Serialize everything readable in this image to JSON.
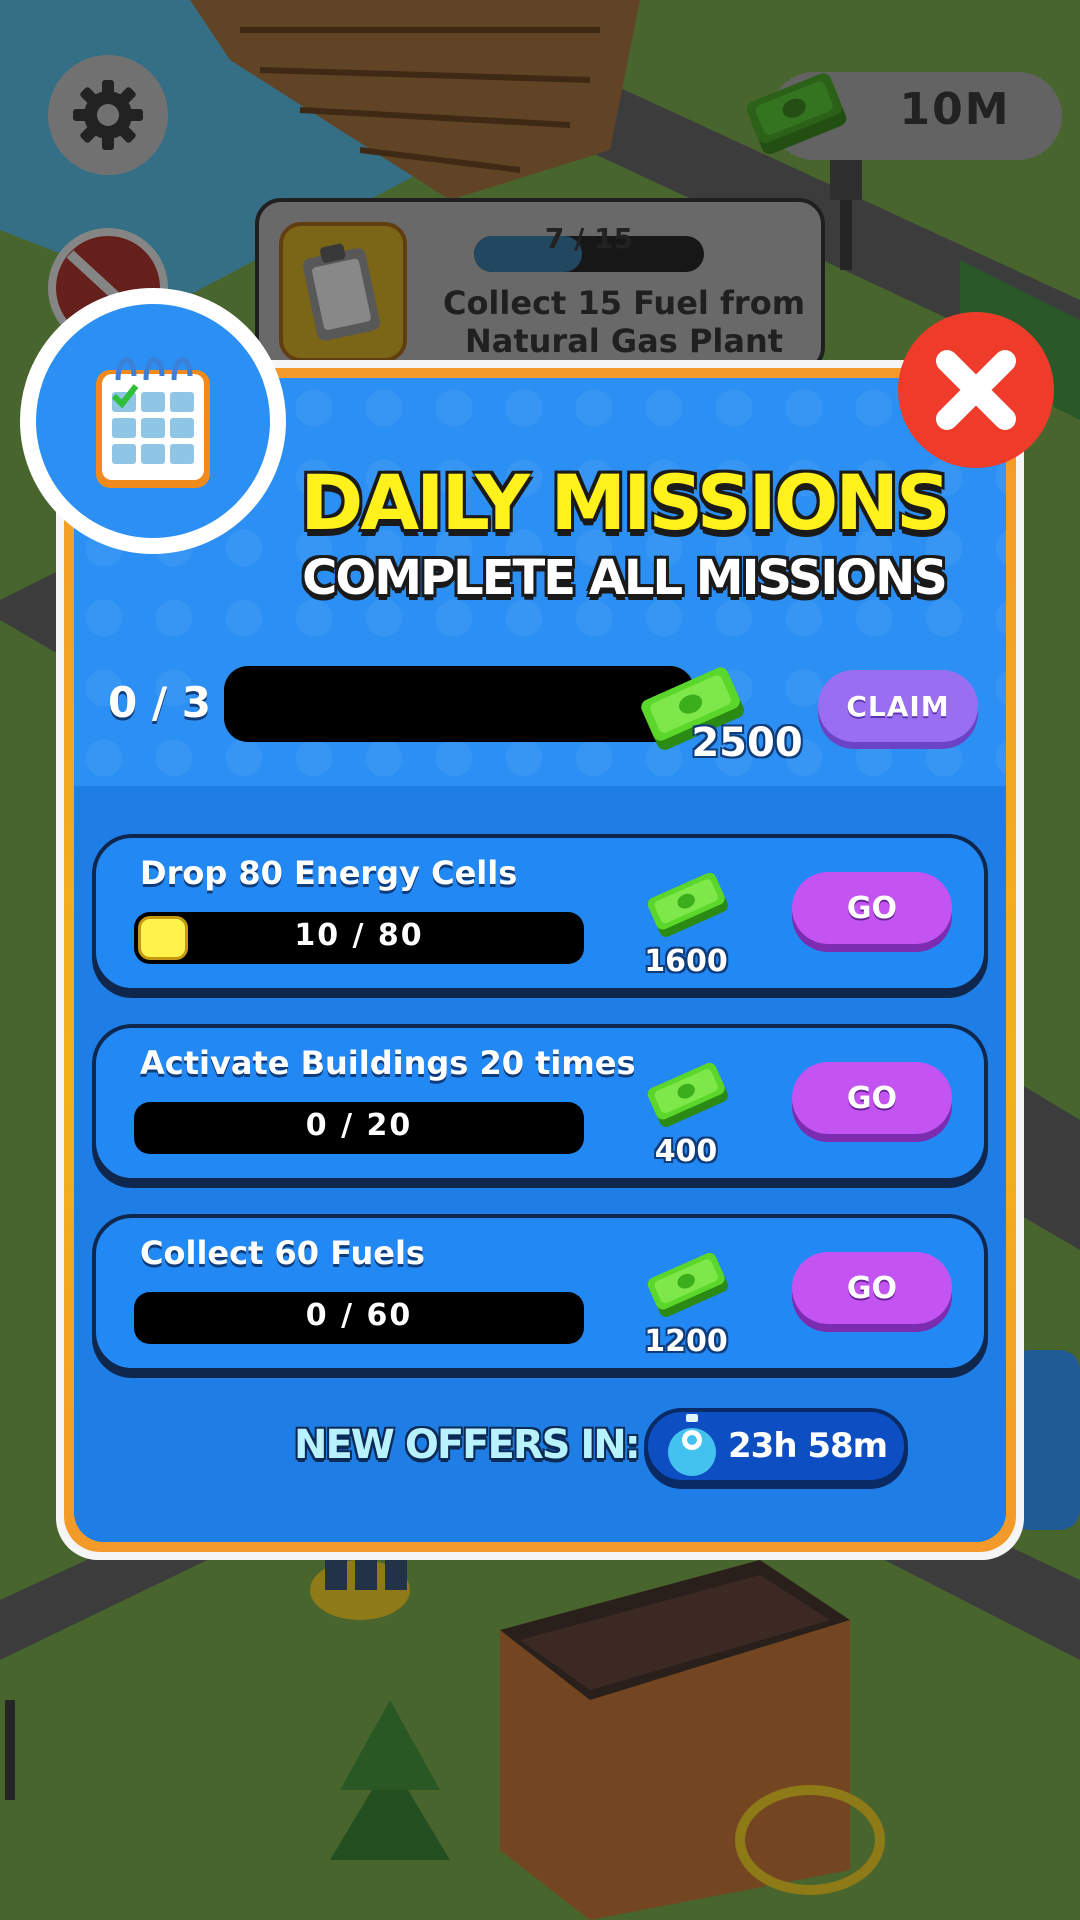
{
  "hud": {
    "money": "10M",
    "quest": {
      "count": "7 / 15",
      "progress": 0.47,
      "text": "Collect 15 Fuel from Natural Gas Plant"
    }
  },
  "modal": {
    "title": "DAILY MISSIONS",
    "subtitle": "COMPLETE ALL MISSIONS",
    "overall": {
      "count": "0 / 3",
      "reward": "2500",
      "claim_label": "CLAIM"
    },
    "missions": [
      {
        "title": "Drop 80 Energy Cells",
        "count": "10 / 80",
        "progress": 0.125,
        "reward": "1600",
        "go_label": "GO"
      },
      {
        "title": "Activate Buildings 20 times",
        "count": "0 / 20",
        "progress": 0,
        "reward": "400",
        "go_label": "GO"
      },
      {
        "title": "Collect 60 Fuels",
        "count": "0 / 60",
        "progress": 0,
        "reward": "1200",
        "go_label": "GO"
      }
    ],
    "offers_label": "NEW OFFERS IN:",
    "timer": "23h 58m"
  },
  "colors": {
    "title_yellow": "#fff21c",
    "panel_blue": "#2b8ff3",
    "go_purple": "#c354f2",
    "claim_purple": "#9a6ef0",
    "close_red": "#ef3b2a",
    "frame_orange": "#f0b21c"
  },
  "icons": [
    "gear-icon",
    "cash-icon",
    "no-ads-icon",
    "clipboard-icon",
    "calendar-icon",
    "close-icon",
    "stopwatch-icon"
  ]
}
